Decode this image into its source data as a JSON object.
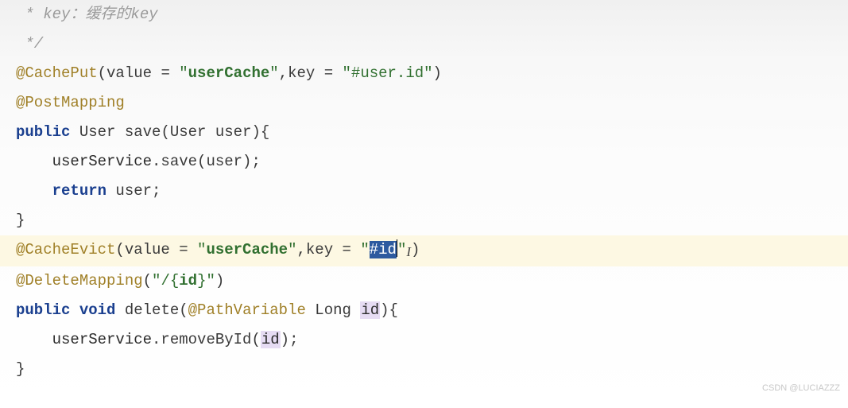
{
  "watermark": "CSDN @LUCIAZZZ",
  "lines": {
    "l1": " * key：缓存的key",
    "l2": " */",
    "l3": {
      "a": "@CachePut",
      "b": "(value = ",
      "c": "\"",
      "d": "userCache",
      "e": "\"",
      "f": ",key = ",
      "g": "\"#user.id\"",
      "h": ")"
    },
    "l4": "@PostMapping",
    "l5": {
      "a": "public",
      "b": " User save(User user){"
    },
    "l6": {
      "a": "    userService",
      "b": ".save(user);"
    },
    "l7": {
      "a": "    ",
      "b": "return",
      "c": " user;"
    },
    "l8": "}",
    "l9": "",
    "l10": {
      "a": "@CacheEvict",
      "b": "(value = ",
      "c": "\"",
      "d": "userCache",
      "e": "\"",
      "f": ",key = ",
      "g": "\"",
      "h": "#id",
      "i": "\"",
      "j": ")"
    },
    "l11": {
      "a": "@DeleteMapping",
      "b": "(",
      "c": "\"/{",
      "d": "id",
      "e": "}\"",
      "f": ")"
    },
    "l12": {
      "a": "public",
      "b": " ",
      "c": "void",
      "d": " delete(",
      "e": "@PathVariable",
      "f": " Long ",
      "g": "id",
      "h": "){"
    },
    "l13": {
      "a": "    userService",
      "b": ".removeById(",
      "c": "id",
      "d": ");"
    },
    "l14": "}"
  },
  "cursor_char": "I"
}
